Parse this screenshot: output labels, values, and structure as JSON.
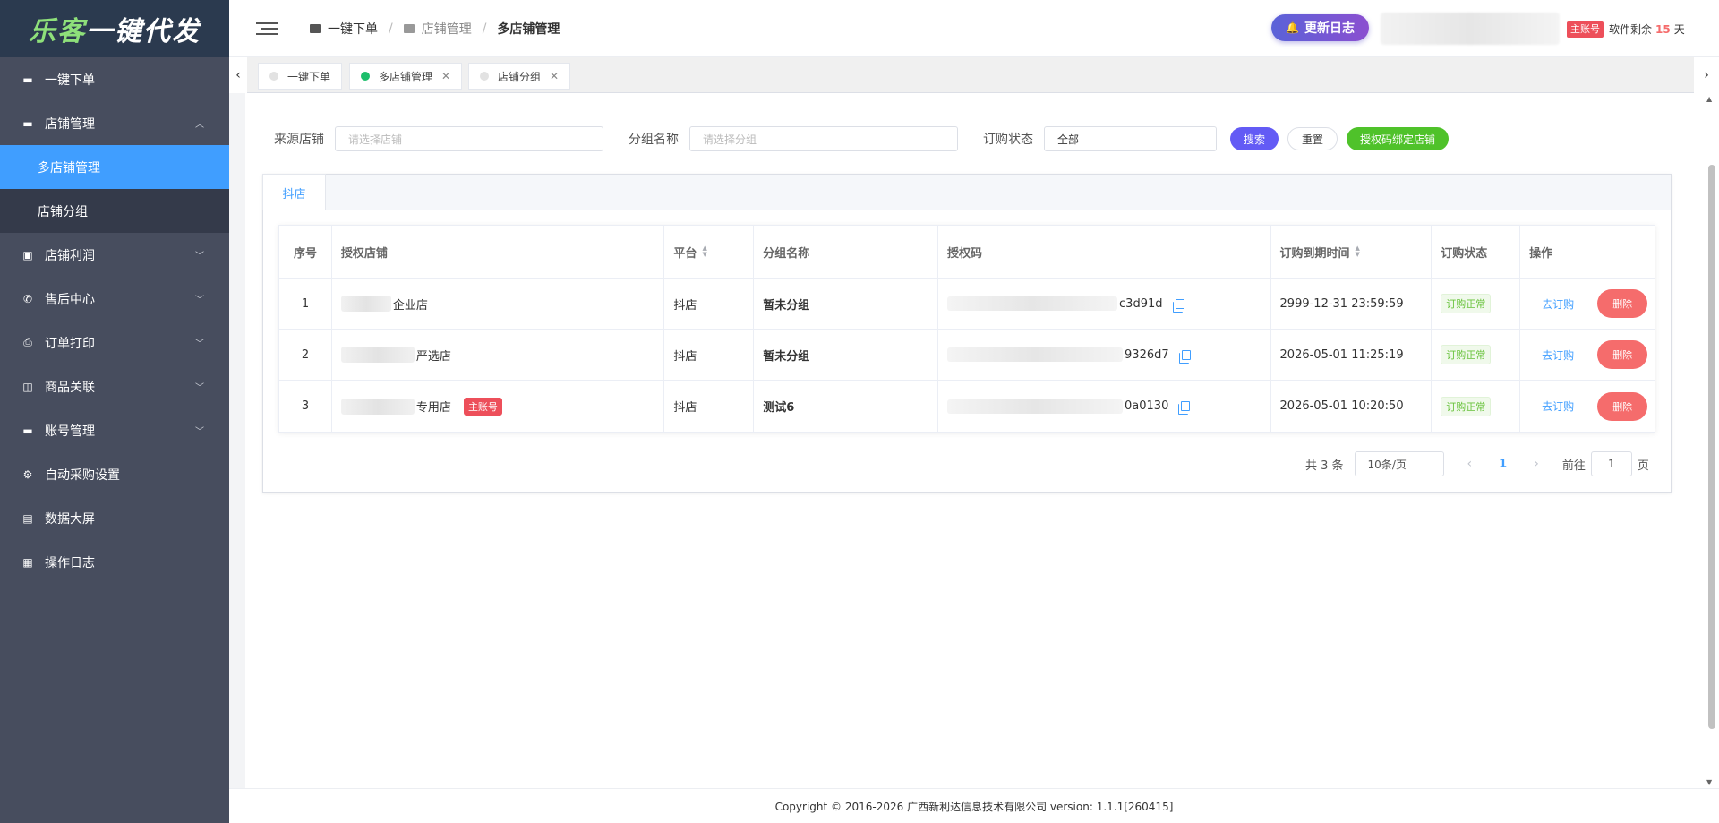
{
  "app": {
    "logo_part1": "乐客",
    "logo_part2": "一键代发"
  },
  "sidebar": {
    "items": [
      {
        "label": "一键下单",
        "icon": "monitor-icon"
      },
      {
        "label": "店铺管理",
        "icon": "monitor-icon",
        "expanded": true
      },
      {
        "label": "多店铺管理",
        "active": true
      },
      {
        "label": "店铺分组"
      },
      {
        "label": "店铺利润",
        "icon": "wallet-icon"
      },
      {
        "label": "售后中心",
        "icon": "phone-icon"
      },
      {
        "label": "订单打印",
        "icon": "printer-icon"
      },
      {
        "label": "商品关联",
        "icon": "shopping-bag-icon"
      },
      {
        "label": "账号管理",
        "icon": "monitor-icon"
      },
      {
        "label": "自动采购设置",
        "icon": "gear-icon"
      },
      {
        "label": "数据大屏",
        "icon": "chart-icon"
      },
      {
        "label": "操作日志",
        "icon": "document-icon"
      }
    ]
  },
  "header": {
    "breadcrumb": [
      "一键下单",
      "店铺管理",
      "多店铺管理"
    ],
    "update_log": "更新日志",
    "role_badge": "主账号",
    "remain_prefix": "软件剩余",
    "remain_days": "15",
    "remain_suffix": "天"
  },
  "tabs": [
    {
      "label": "一键下单"
    },
    {
      "label": "多店铺管理",
      "active": true
    },
    {
      "label": "店铺分组"
    }
  ],
  "filters": {
    "source_shop_label": "来源店铺",
    "source_shop_placeholder": "请选择店铺",
    "group_name_label": "分组名称",
    "group_name_placeholder": "请选择分组",
    "order_status_label": "订购状态",
    "order_status_value": "全部",
    "search_btn": "搜索",
    "reset_btn": "重置",
    "bind_btn": "授权码绑定店铺"
  },
  "card": {
    "tab_label": "抖店"
  },
  "table": {
    "headers": [
      "序号",
      "授权店铺",
      "平台",
      "分组名称",
      "授权码",
      "订购到期时间",
      "订购状态",
      "操作"
    ],
    "rows": [
      {
        "index": "1",
        "shop": "企业店",
        "platform": "抖店",
        "group": "暂未分组",
        "code_suffix": "c3d91d",
        "expire": "2999-12-31 23:59:59",
        "status": "订购正常",
        "order_link": "去订购",
        "delete": "删除"
      },
      {
        "index": "2",
        "shop": "严选店",
        "platform": "抖店",
        "group": "暂未分组",
        "code_suffix": "9326d7",
        "expire": "2026-05-01 11:25:19",
        "status": "订购正常",
        "order_link": "去订购",
        "delete": "删除"
      },
      {
        "index": "3",
        "shop": "专用店",
        "shop_tag": "主账号",
        "platform": "抖店",
        "group": "测试6",
        "code_suffix": "0a0130",
        "expire": "2026-05-01 10:20:50",
        "status": "订购正常",
        "order_link": "去订购",
        "delete": "删除"
      }
    ]
  },
  "pagination": {
    "total": "共 3 条",
    "page_size": "10条/页",
    "current": "1",
    "goto_label": "前往",
    "goto_value": "1",
    "page_suffix": "页"
  },
  "footer": {
    "text": "Copyright © 2016-2026 广西新利达信息技术有限公司   version: 1.1.1[260415]"
  },
  "colors": {
    "sidebar_bg": "#474d5e",
    "active_menu": "#409eff",
    "delete_btn": "#f56c6c",
    "search_btn": "#635bf5",
    "bind_btn": "#4fc22a"
  }
}
